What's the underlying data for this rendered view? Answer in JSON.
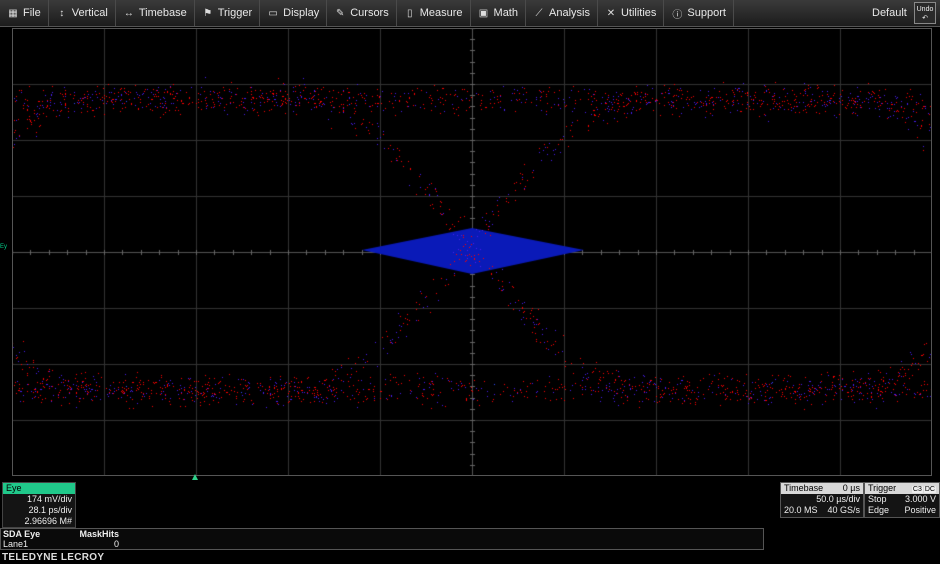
{
  "menu": [
    {
      "label": "File",
      "icon": "grid-icon",
      "glyph": "▦"
    },
    {
      "label": "Vertical",
      "icon": "vertical-arrows-icon",
      "glyph": "↕"
    },
    {
      "label": "Timebase",
      "icon": "horizontal-arrows-icon",
      "glyph": "↔"
    },
    {
      "label": "Trigger",
      "icon": "trigger-flag-icon",
      "glyph": "⚑"
    },
    {
      "label": "Display",
      "icon": "display-icon",
      "glyph": "▭"
    },
    {
      "label": "Cursors",
      "icon": "cursor-pen-icon",
      "glyph": "✎"
    },
    {
      "label": "Measure",
      "icon": "measure-icon",
      "glyph": "▯"
    },
    {
      "label": "Math",
      "icon": "calculator-icon",
      "glyph": "▣"
    },
    {
      "label": "Analysis",
      "icon": "chart-icon",
      "glyph": "⟋"
    },
    {
      "label": "Utilities",
      "icon": "tools-icon",
      "glyph": "✕"
    },
    {
      "label": "Support",
      "icon": "info-icon",
      "glyph": "ⓘ"
    }
  ],
  "toolbar": {
    "default_label": "Default",
    "undo_label": "Undo"
  },
  "channel_marker": "Ey",
  "eye": {
    "name": "Eye",
    "vdiv": "174 mV/div",
    "hdiv": "28.1 ps/div",
    "count": "2.96696 M#",
    "color": "#20c88a"
  },
  "timebase": {
    "title": "Timebase",
    "delay": "0 µs",
    "tdiv": "50.0 µs/div",
    "samples": "20.0 MS",
    "rate": "40 GS/s"
  },
  "trigger": {
    "title": "Trigger",
    "channel_tag": "C3",
    "coupling_tag": "DC",
    "mode": "Stop",
    "level": "3.000 V",
    "type": "Edge",
    "slope": "Positive"
  },
  "measure": {
    "col1": "SDA Eye",
    "col2": "MaskHits",
    "row_label": "Lane1",
    "row_value": "0"
  },
  "brand": "TELEDYNE LECROY"
}
